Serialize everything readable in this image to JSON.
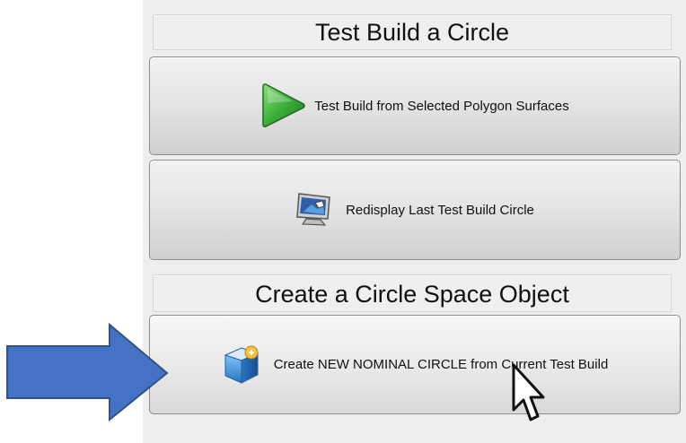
{
  "sections": {
    "test_build": {
      "title": "Test Build a Circle",
      "buttons": {
        "test_build_label": "Test Build from Selected Polygon Surfaces",
        "redisplay_label": "Redisplay Last Test Build Circle"
      }
    },
    "create_object": {
      "title": "Create a Circle Space Object",
      "buttons": {
        "create_label": "Create NEW NOMINAL CIRCLE from Current Test Build"
      }
    }
  },
  "icons": {
    "play": "play-icon",
    "redisplay": "monitor-icon",
    "create": "cube-icon",
    "annotation_arrow": "arrow-right-icon",
    "cursor": "mouse-pointer-icon"
  },
  "colors": {
    "play_green": "#3cae3c",
    "annotation_blue": "#4472c4",
    "cube_blue": "#3b8fd8"
  }
}
